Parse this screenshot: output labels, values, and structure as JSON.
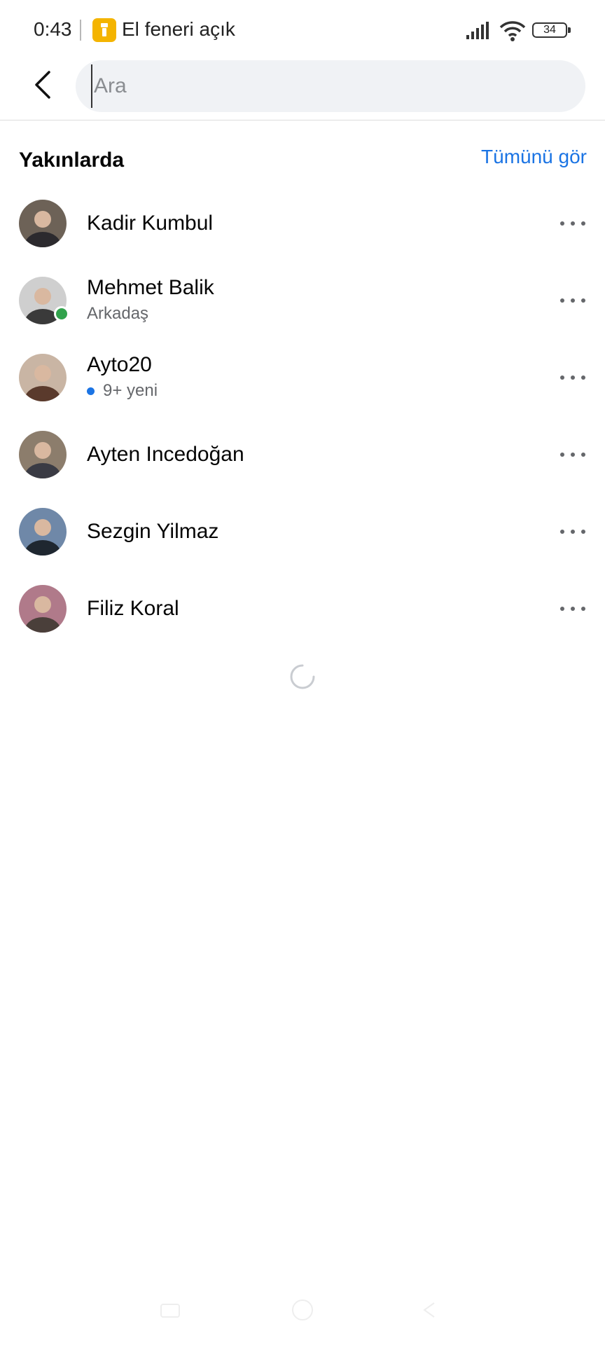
{
  "status_bar": {
    "time": "0:43",
    "torch_label": "El feneri açık",
    "battery_level": "34",
    "icons": [
      "torch-icon",
      "signal-icon",
      "wifi-icon",
      "battery-icon"
    ]
  },
  "header": {
    "back_icon": "chevron-left-icon",
    "search_placeholder": "Ara",
    "search_value": ""
  },
  "section": {
    "title": "Yakınlarda",
    "see_all": "Tümünü gör"
  },
  "contacts": [
    {
      "name": "Kadir Kumbul",
      "subtitle": "",
      "online": false,
      "unread": false,
      "avatar_colors": [
        "#6d6257",
        "#2c2a2e"
      ]
    },
    {
      "name": "Mehmet Balik",
      "subtitle": "Arkadaş",
      "online": true,
      "unread": false,
      "avatar_colors": [
        "#cfcfcf",
        "#3a3a3a"
      ]
    },
    {
      "name": "Ayto20",
      "subtitle": "9+ yeni",
      "online": false,
      "unread": true,
      "avatar_colors": [
        "#c9b5a4",
        "#5a3a2c"
      ]
    },
    {
      "name": "Ayten Incedoğan",
      "subtitle": "",
      "online": false,
      "unread": false,
      "avatar_colors": [
        "#8c7d6c",
        "#3a3b44"
      ]
    },
    {
      "name": "Sezgin Yilmaz",
      "subtitle": "",
      "online": false,
      "unread": false,
      "avatar_colors": [
        "#6f88a8",
        "#1f2730"
      ]
    },
    {
      "name": "Filiz Koral",
      "subtitle": "",
      "online": false,
      "unread": false,
      "avatar_colors": [
        "#b07a8a",
        "#4a3f3a"
      ]
    }
  ],
  "colors": {
    "accent": "#1b74e4",
    "online": "#31a24c",
    "search_bg": "#f0f2f5"
  }
}
